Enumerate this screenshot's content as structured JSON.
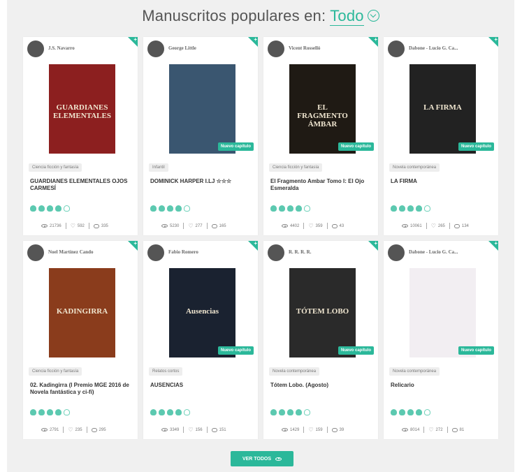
{
  "header": {
    "title": "Manuscritos populares en:",
    "filter": "Todo"
  },
  "cards": [
    {
      "author": "J.S. Navarro",
      "genre": "Ciencia ficción y fantasía",
      "title": "GUARDIANES ELEMENTALES OJOS CARMESÍ",
      "views": "21736",
      "likes": "592",
      "comments": "335",
      "rating": 4,
      "badge": "",
      "cover_text": "GUARDIANES ELEMENTALES",
      "cover_color": "#8c1f1f"
    },
    {
      "author": "George Little",
      "genre": "Infantil",
      "title": "DOMINICK HARPER I.LJ ☆☆☆",
      "views": "5230",
      "likes": "277",
      "comments": "165",
      "rating": 4,
      "badge": "Nuevo capítulo",
      "cover_text": "",
      "cover_color": "#3a5670"
    },
    {
      "author": "Vicent Rosselló",
      "genre": "Ciencia ficción y fantasía",
      "title": "El Fragmento Ambar Tomo I: El Ojo Esmeralda",
      "views": "4402",
      "likes": "359",
      "comments": "43",
      "rating": 4,
      "badge": "Nuevo capítulo",
      "cover_text": "EL FRAGMENTO ÁMBAR",
      "cover_color": "#1f1a14"
    },
    {
      "author": "Dabone - Lucio G. Ca...",
      "genre": "Novela contemporánea",
      "title": "LA FIRMA",
      "views": "10061",
      "likes": "265",
      "comments": "134",
      "rating": 4,
      "badge": "Nuevo capítulo",
      "cover_text": "LA FIRMA",
      "cover_color": "#222222"
    },
    {
      "author": "Noel Martínez Cando",
      "genre": "Ciencia ficción y fantasía",
      "title": "02. Kadingirra (I Premio MGE 2016 de Novela fantástica y ci-fi)",
      "views": "2791",
      "likes": "235",
      "comments": "295",
      "rating": 4,
      "badge": "",
      "cover_text": "KADINGIRRA",
      "cover_color": "#8a3c1c"
    },
    {
      "author": "Fabio Romero",
      "genre": "Relatos cortos",
      "title": "AUSENCIAS",
      "views": "3349",
      "likes": "156",
      "comments": "151",
      "rating": 4,
      "badge": "Nuevo capítulo",
      "cover_text": "Ausencias",
      "cover_color": "#1a2230"
    },
    {
      "author": "R. R. R. R.",
      "genre": "Novela contemporánea",
      "title": "Tótem Lobo. (Agosto)",
      "views": "1429",
      "likes": "159",
      "comments": "39",
      "rating": 4,
      "badge": "Nuevo capítulo",
      "cover_text": "TÓTEM LOBO",
      "cover_color": "#2a2a2a"
    },
    {
      "author": "Dabone - Lucio G. Ca...",
      "genre": "Novela contemporánea",
      "title": "Relicario",
      "views": "8014",
      "likes": "272",
      "comments": "81",
      "rating": 4,
      "badge": "Nuevo capítulo",
      "cover_text": "",
      "cover_color": "#f2eef2"
    }
  ],
  "footer": {
    "see_all": "VER TODOS"
  },
  "colors": {
    "accent": "#2bb89a"
  }
}
